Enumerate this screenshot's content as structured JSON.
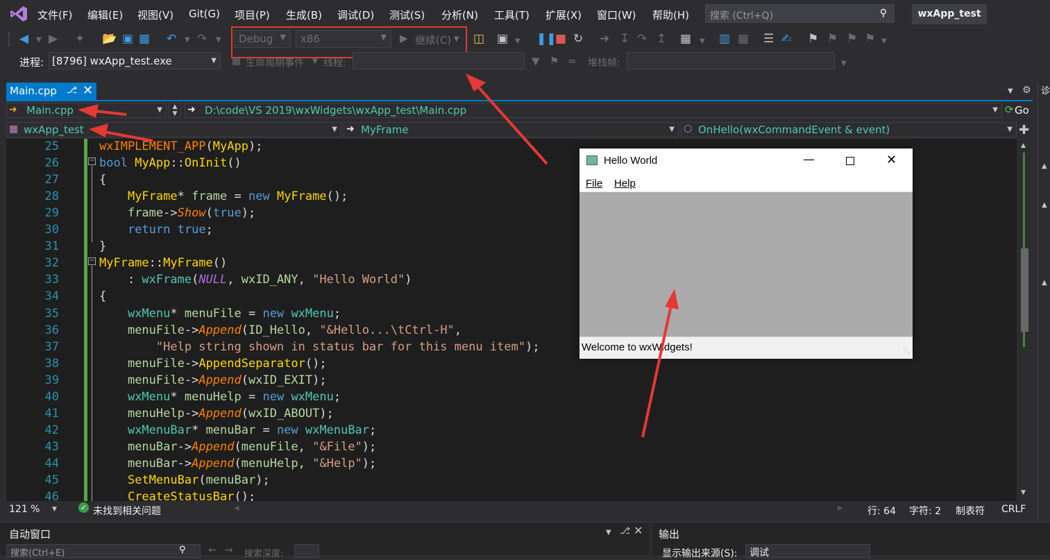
{
  "menu": {
    "items": [
      "文件(F)",
      "编辑(E)",
      "视图(V)",
      "Git(G)",
      "项目(P)",
      "生成(B)",
      "调试(D)",
      "测试(S)",
      "分析(N)",
      "工具(T)",
      "扩展(X)",
      "窗口(W)",
      "帮助(H)"
    ],
    "search_placeholder": "搜索 (Ctrl+Q)",
    "solution_name": "wxApp_test"
  },
  "toolbar": {
    "config": "Debug",
    "platform": "x86",
    "continue_label": "继续(C)",
    "process_label": "进程:",
    "process_value": "[8796] wxApp_test.exe",
    "lifecycle_label": "生命周期事件",
    "thread_label": "线程:",
    "stackframe_label": "堆栈帧:"
  },
  "tab": {
    "title": "Main.cpp"
  },
  "nav": {
    "file": "Main.cpp",
    "path": "D:\\code\\VS 2019\\wxWidgets\\wxApp_test\\Main.cpp",
    "go_label": "Go",
    "project": "wxApp_test",
    "class": "MyFrame",
    "member": "OnHello(wxCommandEvent & event)"
  },
  "editor": {
    "line_numbers": [
      "25",
      "26",
      "27",
      "28",
      "29",
      "30",
      "31",
      "32",
      "33",
      "34",
      "35",
      "36",
      "37",
      "38",
      "39",
      "40",
      "41",
      "42",
      "43",
      "44",
      "45",
      "46"
    ]
  },
  "status": {
    "zoom": "121 %",
    "issues": "未找到相关问题",
    "line": "行: 64",
    "char": "字符: 2",
    "tabs": "制表符",
    "eol": "CRLF"
  },
  "panels": {
    "autos_title": "自动窗口",
    "autos_search": "搜索(Ctrl+E)",
    "search_depth": "搜索深度:",
    "output_title": "输出",
    "output_source_label": "显示输出来源(S):",
    "output_source": "调试"
  },
  "hello_window": {
    "title": "Hello World",
    "menu_file": "File",
    "menu_help": "Help",
    "status": "Welcome to wxWidgets!"
  }
}
